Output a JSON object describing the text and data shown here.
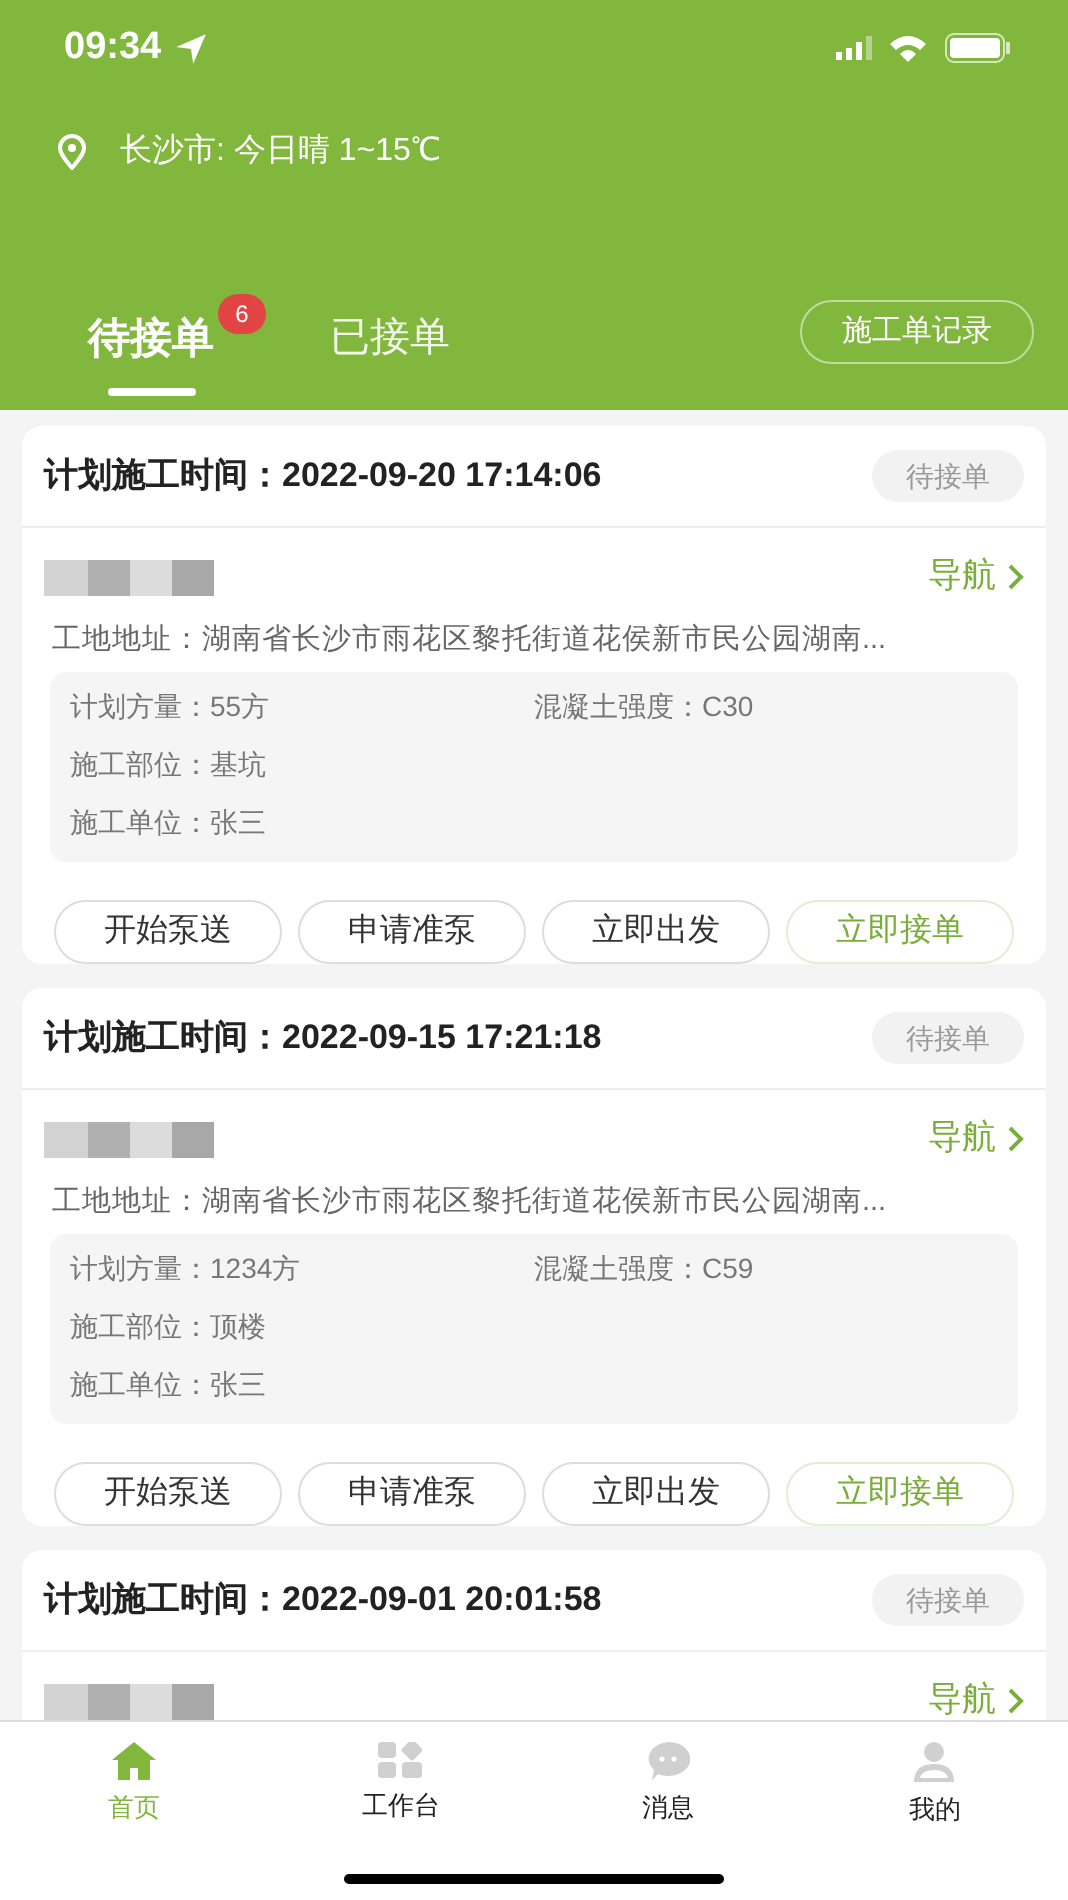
{
  "status_bar": {
    "time": "09:34"
  },
  "weather": {
    "text": "长沙市: 今日晴 1~15℃"
  },
  "tabs": [
    {
      "label": "待接单",
      "selected": true,
      "badge": "6"
    },
    {
      "label": "已接单",
      "selected": false
    }
  ],
  "records_button": "施工单记录",
  "orders": [
    {
      "time_label": "计划施工时间：",
      "time": "2022-09-20 17:14:06",
      "status": "待接单",
      "nav": "导航",
      "address_label": "工地地址：",
      "address": "湖南省长沙市雨花区黎托街道花侯新市民公园湖南...",
      "details": [
        [
          {
            "label": "计划方量：",
            "value": "55方"
          },
          {
            "label": "混凝土强度：",
            "value": "C30"
          }
        ],
        [
          {
            "label": "施工部位：",
            "value": "基坑"
          }
        ],
        [
          {
            "label": "施工单位：",
            "value": "张三"
          }
        ]
      ],
      "actions": [
        {
          "label": "开始泵送",
          "kind": "plain"
        },
        {
          "label": "申请准泵",
          "kind": "plain"
        },
        {
          "label": "立即出发",
          "kind": "plain"
        },
        {
          "label": "立即接单",
          "kind": "primary"
        }
      ]
    },
    {
      "time_label": "计划施工时间：",
      "time": "2022-09-15 17:21:18",
      "status": "待接单",
      "nav": "导航",
      "address_label": "工地地址：",
      "address": "湖南省长沙市雨花区黎托街道花侯新市民公园湖南...",
      "details": [
        [
          {
            "label": "计划方量：",
            "value": "1234方"
          },
          {
            "label": "混凝土强度：",
            "value": "C59"
          }
        ],
        [
          {
            "label": "施工部位：",
            "value": "顶楼"
          }
        ],
        [
          {
            "label": "施工单位：",
            "value": "张三"
          }
        ]
      ],
      "actions": [
        {
          "label": "开始泵送",
          "kind": "plain"
        },
        {
          "label": "申请准泵",
          "kind": "plain"
        },
        {
          "label": "立即出发",
          "kind": "plain"
        },
        {
          "label": "立即接单",
          "kind": "primary"
        }
      ]
    },
    {
      "time_label": "计划施工时间：",
      "time": "2022-09-01 20:01:58",
      "status": "待接单",
      "nav": "导航"
    }
  ],
  "bottom_nav": [
    {
      "label": "首页",
      "selected": true
    },
    {
      "label": "工作台",
      "selected": false
    },
    {
      "label": "消息",
      "selected": false
    },
    {
      "label": "我的",
      "selected": false
    }
  ]
}
